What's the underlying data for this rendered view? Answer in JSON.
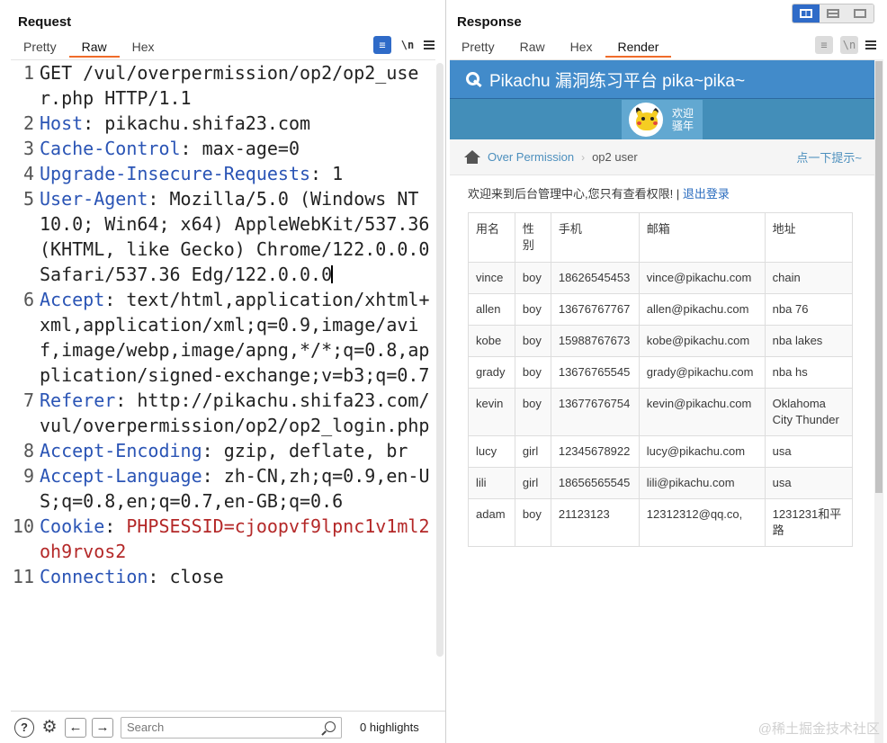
{
  "layout_switch": {
    "options": [
      "side-by-side",
      "vertical",
      "tabs"
    ]
  },
  "request": {
    "title": "Request",
    "tabs": [
      "Pretty",
      "Raw",
      "Hex"
    ],
    "active_tab": "Raw",
    "tools": {
      "wrap_label": "\\n"
    },
    "lines": [
      {
        "num": "1",
        "key": "",
        "sep": "",
        "value": "GET /vul/overpermission/op2/op2_user.php HTTP/1.1"
      },
      {
        "num": "2",
        "key": "Host",
        "sep": ":",
        "value": " pikachu.shifa23.com"
      },
      {
        "num": "3",
        "key": "Cache-Control",
        "sep": ":",
        "value": " max-age=0"
      },
      {
        "num": "4",
        "key": "Upgrade-Insecure-Requests",
        "sep": ":",
        "value": " 1"
      },
      {
        "num": "5",
        "key": "User-Agent",
        "sep": ":",
        "value": " Mozilla/5.0 (Windows NT 10.0; Win64; x64) AppleWebKit/537.36 (KHTML, like Gecko) Chrome/122.0.0.0 Safari/537.36 Edg/122.0.0.0"
      },
      {
        "num": "6",
        "key": "Accept",
        "sep": ":",
        "value": " text/html,application/xhtml+xml,application/xml;q=0.9,image/avif,image/webp,image/apng,*/*;q=0.8,application/signed-exchange;v=b3;q=0.7"
      },
      {
        "num": "7",
        "key": "Referer",
        "sep": ":",
        "value": " http://pikachu.shifa23.com/vul/overpermission/op2/op2_login.php"
      },
      {
        "num": "8",
        "key": "Accept-Encoding",
        "sep": ":",
        "value": " gzip, deflate, br"
      },
      {
        "num": "9",
        "key": "Accept-Language",
        "sep": ":",
        "value": " zh-CN,zh;q=0.9,en-US;q=0.8,en;q=0.7,en-GB;q=0.6"
      },
      {
        "num": "10",
        "key": "Cookie",
        "sep": ":",
        "value": " PHPSESSID=cjoopvf9lpnc1v1ml2oh9rvos2"
      },
      {
        "num": "11",
        "key": "Connection",
        "sep": ":",
        "value": " close"
      }
    ],
    "search": {
      "placeholder": "Search",
      "value": ""
    },
    "highlights": "0 highlights"
  },
  "response": {
    "title": "Response",
    "tabs": [
      "Pretty",
      "Raw",
      "Hex",
      "Render"
    ],
    "active_tab": "Render",
    "tools": {
      "wrap_label": "\\n"
    },
    "page": {
      "header_title": "Pikachu 漏洞练习平台 pika~pika~",
      "welcome_tag_line1": "欢迎",
      "welcome_tag_line2": "骚年",
      "breadcrumb": {
        "parent": "Over Permission",
        "current": "op2 user"
      },
      "hint_link": "点一下提示~",
      "welcome_text": "欢迎来到后台管理中心,您只有查看权限! | ",
      "logout_text": "退出登录",
      "table": {
        "headers": [
          "用名",
          "性别",
          "手机",
          "邮箱",
          "地址"
        ],
        "rows": [
          [
            "vince",
            "boy",
            "18626545453",
            "vince@pikachu.com",
            "chain"
          ],
          [
            "allen",
            "boy",
            "13676767767",
            "allen@pikachu.com",
            "nba 76"
          ],
          [
            "kobe",
            "boy",
            "15988767673",
            "kobe@pikachu.com",
            "nba lakes"
          ],
          [
            "grady",
            "boy",
            "13676765545",
            "grady@pikachu.com",
            "nba hs"
          ],
          [
            "kevin",
            "boy",
            "13677676754",
            "kevin@pikachu.com",
            "Oklahoma City Thunder"
          ],
          [
            "lucy",
            "girl",
            "12345678922",
            "lucy@pikachu.com",
            "usa"
          ],
          [
            "lili",
            "girl",
            "18656565545",
            "lili@pikachu.com",
            "usa"
          ],
          [
            "adam",
            "boy",
            "21123123",
            "12312312@qq.co,",
            "1231231和平路"
          ]
        ]
      }
    }
  },
  "watermark": "@稀土掘金技术社区",
  "colors": {
    "accent": "#2f6bc8",
    "tab_underline": "#f06c2a",
    "header_blue": "#428bca",
    "link": "#4c8fbd",
    "cookie_value": "#b42828",
    "header_key": "#2a54b5"
  }
}
